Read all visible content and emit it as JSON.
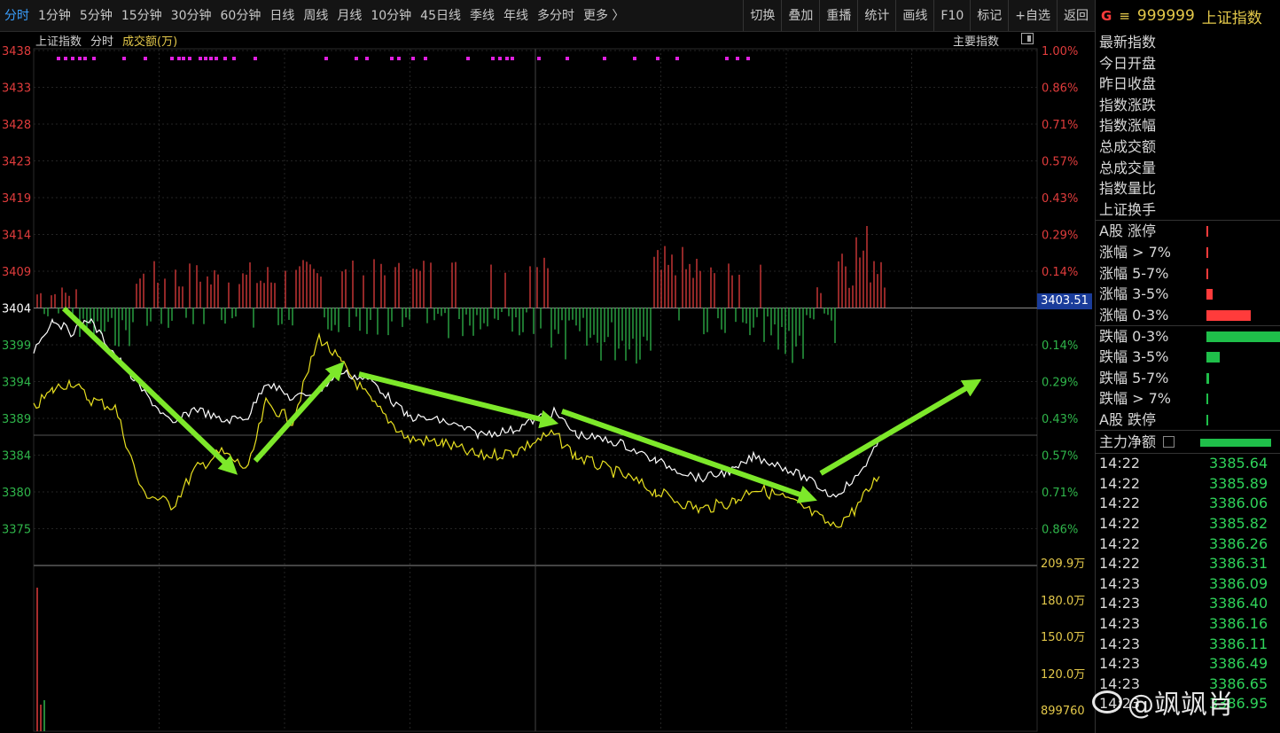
{
  "toolbar": {
    "periods": [
      "分时",
      "1分钟",
      "5分钟",
      "15分钟",
      "30分钟",
      "60分钟",
      "日线",
      "周线",
      "月线",
      "10分钟",
      "45日线",
      "季线",
      "年线",
      "多分时",
      "更多 〉"
    ],
    "tools": [
      "切换",
      "叠加",
      "重播",
      "统计",
      "画线",
      "F10",
      "标记",
      "+自选",
      "返回"
    ]
  },
  "chart_header": {
    "name": "上证指数",
    "mode": "分时",
    "vol_label": "成交额(万)",
    "main_index": "主要指数"
  },
  "price_tag": "3403.51",
  "axis": {
    "left_prices": [
      "3438",
      "3433",
      "3428",
      "3423",
      "3419",
      "3414",
      "3409",
      "3404",
      "3399",
      "3394",
      "3389",
      "3384",
      "3380",
      "3375"
    ],
    "right_pcts": [
      "1.00%",
      "0.86%",
      "0.71%",
      "0.57%",
      "0.43%",
      "0.29%",
      "0.14%",
      "",
      "0.14%",
      "0.29%",
      "0.43%",
      "0.57%",
      "0.71%",
      "0.86%"
    ],
    "vol_ticks": [
      "209.9万",
      "180.0万",
      "150.0万",
      "120.0万",
      "899760"
    ]
  },
  "colors": {
    "up": "#e03c3c",
    "down": "#2fb54a",
    "price_line": "#ffffff",
    "avg_line": "#e8e020",
    "arrow": "#7de82a",
    "accent": "#e3c84a"
  },
  "right_panel": {
    "g": "G",
    "eq": "≡",
    "code": "999999",
    "name": "上证指数",
    "stats": [
      "最新指数",
      "今日开盘",
      "昨日收盘",
      "指数涨跌",
      "指数涨幅",
      "总成交额",
      "总成交量",
      "指数量比",
      "上证换手"
    ],
    "breadth": [
      {
        "label": "A股 涨停",
        "color": "red",
        "level": 0.02
      },
      {
        "label": "涨幅 > 7%",
        "color": "red",
        "level": 0.02
      },
      {
        "label": "涨幅 5-7%",
        "color": "red",
        "level": 0.01
      },
      {
        "label": "涨幅 3-5%",
        "color": "red",
        "level": 0.08
      },
      {
        "label": "涨幅 0-3%",
        "color": "red",
        "level": 0.6
      },
      {
        "label": "跌幅 0-3%",
        "color": "green",
        "level": 1.0
      },
      {
        "label": "跌幅 3-5%",
        "color": "green",
        "level": 0.18
      },
      {
        "label": "跌幅 5-7%",
        "color": "green",
        "level": 0.04
      },
      {
        "label": "跌幅 > 7%",
        "color": "green",
        "level": 0.01
      },
      {
        "label": "A股 跌停",
        "color": "green",
        "level": 0.01
      }
    ],
    "main_flow": "主力净额",
    "ticks": [
      {
        "t": "14:22",
        "v": "3385.64"
      },
      {
        "t": "14:22",
        "v": "3385.89"
      },
      {
        "t": "14:22",
        "v": "3386.06"
      },
      {
        "t": "14:22",
        "v": "3385.82"
      },
      {
        "t": "14:22",
        "v": "3386.26"
      },
      {
        "t": "14:22",
        "v": "3386.31"
      },
      {
        "t": "14:23",
        "v": "3386.09"
      },
      {
        "t": "14:23",
        "v": "3386.40"
      },
      {
        "t": "14:23",
        "v": "3386.16"
      },
      {
        "t": "14:23",
        "v": "3386.11"
      },
      {
        "t": "14:23",
        "v": "3386.49"
      },
      {
        "t": "14:23",
        "v": "3386.65"
      },
      {
        "t": "14:23",
        "v": "3386.95"
      }
    ]
  },
  "watermark": "@飒飒肖"
}
